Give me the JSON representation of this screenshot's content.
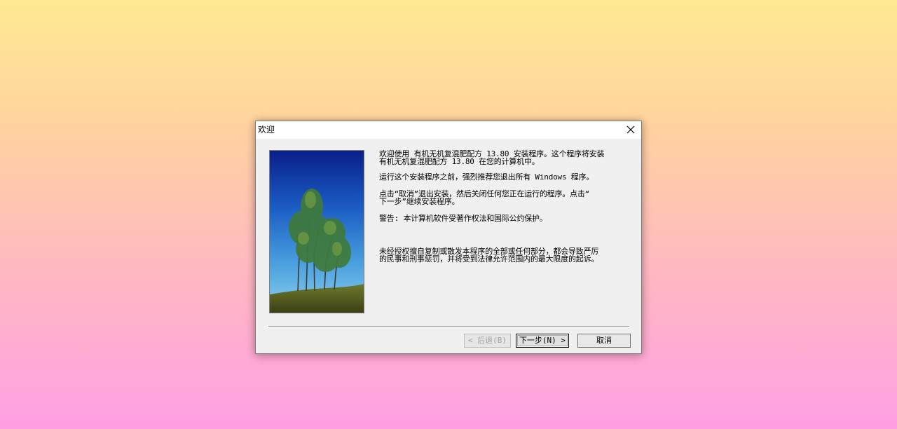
{
  "window": {
    "title": "欢迎"
  },
  "body": {
    "paragraphs": [
      "欢迎使用 有机无机复混肥配方 13.80 安装程序。这个程序将安装\n有机无机复混肥配方 13.80 在您的计算机中。",
      "运行这个安装程序之前，强烈推荐您退出所有 Windows 程序。",
      "点击“取消”退出安装，然后关闭任何您正在运行的程序。点击“\n下一步”继续安装程序。",
      "警告: 本计算机软件受著作权法和国际公约保护。",
      "未经授权擅自复制或散发本程序的全部或任何部分，都会导致严厉\n的民事和刑事惩罚，并将受到法律允许范围内的最大限度的起诉。"
    ]
  },
  "buttons": {
    "back": "< 后退(B)",
    "next": "下一步(N) >",
    "cancel": "取消"
  },
  "colors": {
    "dialog_bg": "#f0f0f0",
    "titlebar_bg": "#ffffff",
    "desktop_top": "#ffe993",
    "desktop_bottom": "#ff9fe4"
  }
}
